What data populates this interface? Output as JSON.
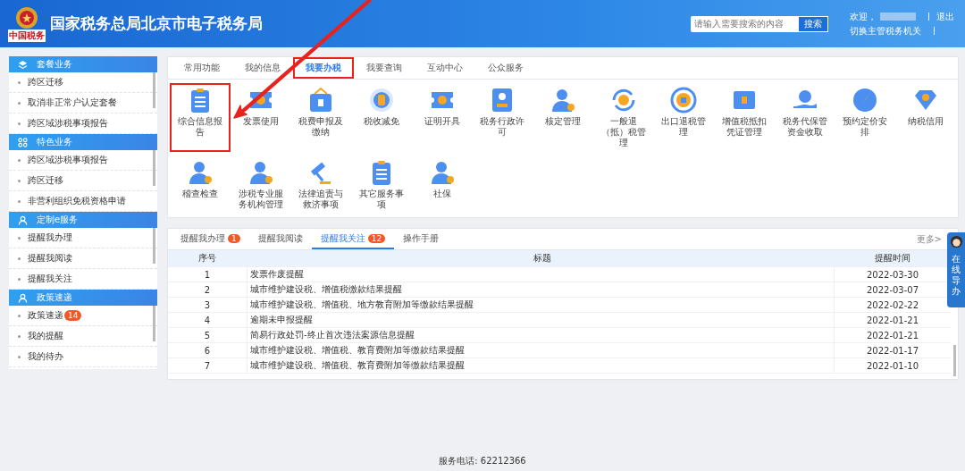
{
  "header": {
    "title": "国家税务总局北京市电子税务局",
    "logo_caption": "中国税务",
    "search": {
      "placeholder": "请输入需要搜索的内容",
      "button": "搜索"
    },
    "welcome": "欢迎，",
    "logout": "退出",
    "switch": "切换主管税务机关"
  },
  "sidebar": [
    {
      "title": "套餐业务",
      "items": [
        {
          "label": "跨区迁移"
        },
        {
          "label": "取消非正常户认定套餐"
        },
        {
          "label": "跨区域涉税事项报告"
        }
      ]
    },
    {
      "title": "特色业务",
      "items": [
        {
          "label": "跨区域涉税事项报告"
        },
        {
          "label": "跨区迁移"
        },
        {
          "label": "非营利组织免税资格申请"
        }
      ]
    },
    {
      "title": "定制e服务",
      "items": [
        {
          "label": "提醒我办理"
        },
        {
          "label": "提醒我阅读"
        },
        {
          "label": "提醒我关注"
        }
      ]
    },
    {
      "title": "政策速递",
      "items": [
        {
          "label": "政策速递",
          "badge": "14"
        },
        {
          "label": "我的提醒"
        },
        {
          "label": "我的待办"
        }
      ]
    }
  ],
  "tabs": [
    {
      "label": "常用功能",
      "selected": false,
      "highlighted": false
    },
    {
      "label": "我的信息",
      "selected": false,
      "highlighted": false
    },
    {
      "label": "我要办税",
      "selected": true,
      "highlighted": true
    },
    {
      "label": "我要查询",
      "selected": false,
      "highlighted": false
    },
    {
      "label": "互动中心",
      "selected": false,
      "highlighted": false
    },
    {
      "label": "公众服务",
      "selected": false,
      "highlighted": false
    }
  ],
  "functions": [
    {
      "label": "综合信息报告",
      "highlighted": true
    },
    {
      "label": "发票使用",
      "highlighted": false
    },
    {
      "label": "税费申报及缴纳",
      "highlighted": false
    },
    {
      "label": "税收减免",
      "highlighted": false
    },
    {
      "label": "证明开具",
      "highlighted": false
    },
    {
      "label": "税务行政许可",
      "highlighted": false
    },
    {
      "label": "核定管理",
      "highlighted": false
    },
    {
      "label": "一般退（抵）税管理",
      "highlighted": false
    },
    {
      "label": "出口退税管理",
      "highlighted": false
    },
    {
      "label": "增值税抵扣凭证管理",
      "highlighted": false
    },
    {
      "label": "税务代保管资金收取",
      "highlighted": false
    },
    {
      "label": "预约定价安排",
      "highlighted": false
    },
    {
      "label": "纳税信用",
      "highlighted": false
    },
    {
      "label": "稽查检查",
      "highlighted": false
    },
    {
      "label": "涉税专业服务机构管理",
      "highlighted": false
    },
    {
      "label": "法律追责与救济事项",
      "highlighted": false
    },
    {
      "label": "其它服务事项",
      "highlighted": false
    },
    {
      "label": "社保",
      "highlighted": false
    }
  ],
  "notice_tabs": [
    {
      "label": "提醒我办理",
      "badge": "1",
      "selected": false
    },
    {
      "label": "提醒我阅读",
      "selected": false
    },
    {
      "label": "提醒我关注",
      "badge": "12",
      "selected": true
    },
    {
      "label": "操作手册",
      "selected": false
    }
  ],
  "more_link": "更多>",
  "table": {
    "columns": [
      "序号",
      "标题",
      "提醒时间"
    ],
    "rows": [
      [
        "1",
        "发票作废提醒",
        "2022-03-30"
      ],
      [
        "2",
        "城市维护建设税、增值税缴款结果提醒",
        "2022-03-07"
      ],
      [
        "3",
        "城市维护建设税、增值税、地方教育附加等缴款结果提醒",
        "2022-02-22"
      ],
      [
        "4",
        "逾期未申报提醒",
        "2022-01-21"
      ],
      [
        "5",
        "简易行政处罚-终止首次违法案源信息提醒",
        "2022-01-21"
      ],
      [
        "6",
        "城市维护建设税、增值税、教育费附加等缴款结果提醒",
        "2022-01-17"
      ],
      [
        "7",
        "城市维护建设税、增值税、教育费附加等缴款结果提醒",
        "2022-01-10"
      ]
    ]
  },
  "float_widget": {
    "label": "在线导办"
  },
  "footer": "服务电话: 62212366"
}
